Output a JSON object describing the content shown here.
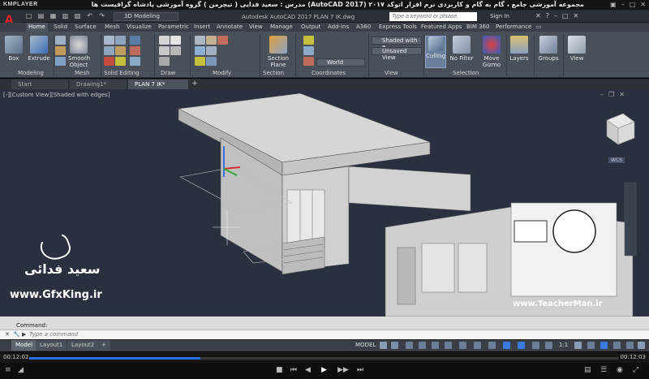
{
  "player": {
    "logo": "KMPLAYER",
    "video_title": "مجموعه آموزشی جامع ، گام به گام و کاربردی نرم افزار   اتوکد ۲۰۱۷ (AutoCAD 2017)   مدرس : سعید فدایی ( تیچرمن ) گروه آموزشی پادشاه گرافیست ها",
    "time_elapsed": "00:12:02",
    "time_total": "00:12:03",
    "progress_fraction": 0.29
  },
  "acad": {
    "workspace": "3D Modeling",
    "app_title": "Autodesk AutoCAD 2017    PLAN 7 IK.dwg",
    "search_placeholder": "Type a keyword or phrase",
    "sign_in": "Sign In"
  },
  "ribbon_tabs": [
    "Home",
    "Solid",
    "Surface",
    "Mesh",
    "Visualize",
    "Parametric",
    "Insert",
    "Annotate",
    "View",
    "Manage",
    "Output",
    "Add-ins",
    "A360",
    "Express Tools",
    "Featured Apps",
    "BIM 360",
    "Performance"
  ],
  "ribbon": {
    "buttons": {
      "box": "Box",
      "extrude": "Extrude",
      "smooth_object": "Smooth\nObject",
      "section_plane": "Section\nPlane",
      "culling": "Culling",
      "no_filter": "No Filter",
      "move_gizmo": "Move\nGizmo",
      "layers": "Layers",
      "groups": "Groups",
      "view": "View"
    },
    "visual_style": "Shaded with e...",
    "view_state": "Unsaved View",
    "ucs": "World",
    "panels": [
      "Modeling",
      "Mesh",
      "Solid Editing",
      "Draw",
      "Modify",
      "Section",
      "Coordinates",
      "View",
      "Selection"
    ]
  },
  "file_tabs": [
    "Start",
    "Drawing1*",
    "PLAN 7 IK*"
  ],
  "viewport": {
    "label": "[-][Custom View][Shaded with edges]",
    "wcs": "WCS"
  },
  "watermark": {
    "name": "سعید فدائی",
    "site_left": "www.GfxKing.ir",
    "site_right": "www.TeacherMan.ir"
  },
  "command": {
    "history": "Command:",
    "placeholder": "Type a command"
  },
  "layout_tabs": [
    "Model",
    "Layout1",
    "Layout2"
  ],
  "status": {
    "model": "MODEL",
    "scale": "1:1"
  }
}
